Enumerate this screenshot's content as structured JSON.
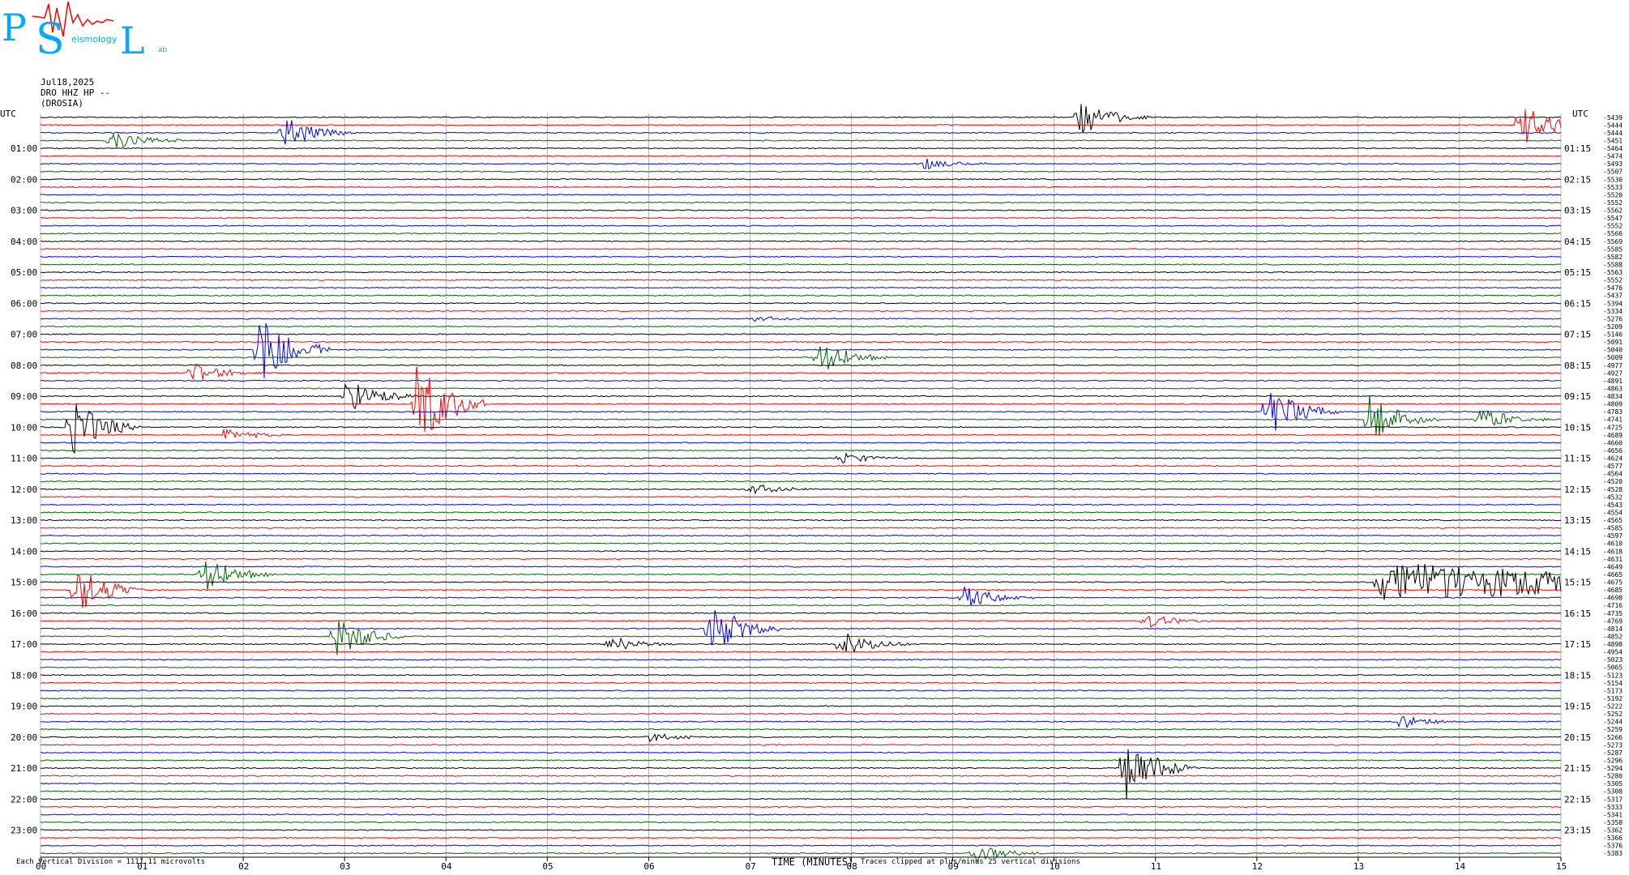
{
  "logo": {
    "letters": [
      "P",
      "S",
      "L"
    ],
    "subtitle_parts": [
      "eismology",
      "ab"
    ]
  },
  "header": {
    "date": "Jul18,2025",
    "station": "DRO HHZ HP --",
    "location": "(DROSIA)"
  },
  "footer": {
    "scale": "Each Vertical Division = 1111.11 microvolts",
    "xlabel": "TIME (MINUTES)",
    "clip_note": "Traces clipped at plus/minus 25 vertical divisions"
  },
  "colors": {
    "trace": [
      "#000000",
      "#ff0000",
      "#0000ff",
      "#006400"
    ],
    "grid": "#888888",
    "logo": "#00aaff",
    "logo_wave": "#ff0000"
  },
  "chart_data": {
    "type": "line",
    "title": "",
    "xlabel": "TIME (MINUTES)",
    "ylabel": "",
    "xlim": [
      0,
      15
    ],
    "x_ticks": [
      "00",
      "01",
      "02",
      "03",
      "04",
      "05",
      "06",
      "07",
      "08",
      "09",
      "10",
      "11",
      "12",
      "13",
      "14",
      "15"
    ],
    "left_axis_label": "UTC",
    "right_axis_label": "UTC",
    "left_hour_labels": [
      "01:00",
      "02:00",
      "03:00",
      "04:00",
      "05:00",
      "06:00",
      "07:00",
      "08:00",
      "09:00",
      "10:00",
      "11:00",
      "12:00",
      "13:00",
      "14:00",
      "15:00",
      "16:00",
      "17:00",
      "18:00",
      "19:00",
      "20:00",
      "21:00",
      "22:00",
      "23:00"
    ],
    "right_hour_labels": [
      "01:15",
      "02:15",
      "03:15",
      "04:15",
      "05:15",
      "06:15",
      "07:15",
      "08:15",
      "09:15",
      "10:15",
      "11:15",
      "12:15",
      "13:15",
      "14:15",
      "15:15",
      "16:15",
      "17:15",
      "18:15",
      "19:15",
      "20:15",
      "21:15",
      "22:15",
      "23:15"
    ],
    "trace_count": 96,
    "trace_minutes": 15,
    "right_offsets": [
      "-5439",
      "-5444",
      "-5444",
      "-5451",
      "-5464",
      "-5474",
      "-5493",
      "-5507",
      "-5530",
      "-5533",
      "-5520",
      "-5552",
      "-5562",
      "-5547",
      "-5552",
      "-5566",
      "-5569",
      "-5585",
      "-5582",
      "-5588",
      "-5563",
      "-5552",
      "-5476",
      "-5437",
      "-5394",
      "-5334",
      "-5276",
      "-5209",
      "-5146",
      "-5091",
      "-5040",
      "-5009",
      "-4977",
      "-4927",
      "-4891",
      "-4863",
      "-4834",
      "-4809",
      "-4783",
      "-4741",
      "-4725",
      "-4689",
      "-4660",
      "-4656",
      "-4624",
      "-4577",
      "-4564",
      "-4520",
      "-4528",
      "-4532",
      "-4543",
      "-4554",
      "-4565",
      "-4585",
      "-4597",
      "-4610",
      "-4618",
      "-4631",
      "-4649",
      "-4665",
      "-4675",
      "-4685",
      "-4698",
      "-4716",
      "-4735",
      "-4769",
      "-4814",
      "-4852",
      "-4898",
      "-4954",
      "-5023",
      "-5065",
      "-5123",
      "-5154",
      "-5173",
      "-5192",
      "-5222",
      "-5252",
      "-5244",
      "-5259",
      "-5266",
      "-5273",
      "-5287",
      "-5296",
      "-5294",
      "-5280",
      "-5305",
      "-5308",
      "-5317",
      "-5333",
      "-5341",
      "-5358",
      "-5362",
      "-5366",
      "-5376",
      "-5383"
    ],
    "events": [
      {
        "trace": 0,
        "minute": 10.25,
        "amplitude": 1.6
      },
      {
        "trace": 1,
        "minute": 14.6,
        "amplitude": 2.0
      },
      {
        "trace": 2,
        "minute": 2.4,
        "amplitude": 1.4
      },
      {
        "trace": 3,
        "minute": 0.7,
        "amplitude": 0.8
      },
      {
        "trace": 6,
        "minute": 8.7,
        "amplitude": 0.5
      },
      {
        "trace": 26,
        "minute": 7.0,
        "amplitude": 0.3
      },
      {
        "trace": 30,
        "minute": 2.15,
        "amplitude": 3.2
      },
      {
        "trace": 31,
        "minute": 7.65,
        "amplitude": 1.6
      },
      {
        "trace": 33,
        "minute": 1.5,
        "amplitude": 0.9
      },
      {
        "trace": 36,
        "minute": 3.0,
        "amplitude": 1.6
      },
      {
        "trace": 37,
        "minute": 3.7,
        "amplitude": 4.0
      },
      {
        "trace": 38,
        "minute": 12.1,
        "amplitude": 2.4
      },
      {
        "trace": 39,
        "minute": 13.1,
        "amplitude": 2.2
      },
      {
        "trace": 40,
        "minute": 0.3,
        "amplitude": 2.4
      },
      {
        "trace": 39,
        "minute": 14.2,
        "amplitude": 1.0
      },
      {
        "trace": 41,
        "minute": 1.8,
        "amplitude": 0.5
      },
      {
        "trace": 44,
        "minute": 7.9,
        "amplitude": 0.5
      },
      {
        "trace": 48,
        "minute": 7.0,
        "amplitude": 0.5
      },
      {
        "trace": 59,
        "minute": 1.6,
        "amplitude": 1.6
      },
      {
        "trace": 61,
        "minute": 0.35,
        "amplitude": 2.2
      },
      {
        "trace": 60,
        "minute": 13.2,
        "amplitude": 1.8,
        "long": true
      },
      {
        "trace": 62,
        "minute": 9.1,
        "amplitude": 1.0
      },
      {
        "trace": 66,
        "minute": 6.6,
        "amplitude": 2.4
      },
      {
        "trace": 65,
        "minute": 10.9,
        "amplitude": 0.6
      },
      {
        "trace": 67,
        "minute": 2.9,
        "amplitude": 1.8
      },
      {
        "trace": 68,
        "minute": 5.6,
        "amplitude": 0.8
      },
      {
        "trace": 68,
        "minute": 7.9,
        "amplitude": 1.1
      },
      {
        "trace": 78,
        "minute": 13.4,
        "amplitude": 0.6
      },
      {
        "trace": 80,
        "minute": 6.0,
        "amplitude": 0.4
      },
      {
        "trace": 84,
        "minute": 10.7,
        "amplitude": 2.8
      },
      {
        "trace": 95,
        "minute": 9.2,
        "amplitude": 0.8
      }
    ]
  }
}
